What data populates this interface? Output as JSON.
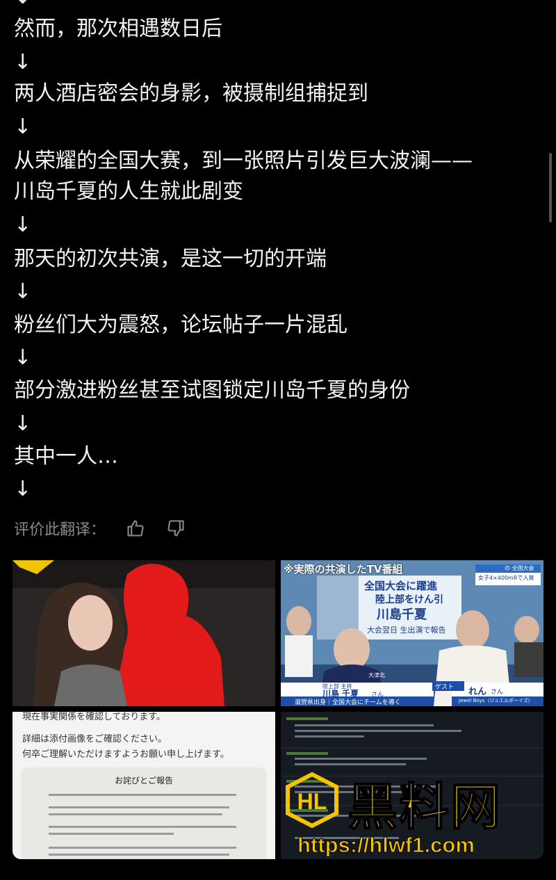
{
  "post": {
    "top_arrow": "↓",
    "lines": [
      "然而，那次相遇数日后",
      "↓",
      "两人酒店密会的身影，被摄制组捕捉到",
      "↓",
      "从荣耀的全国大赛，到一张照片引发巨大波澜——",
      "川岛千夏的人生就此剧变",
      "↓",
      "那天的初次共演，是这一切的开端",
      "↓",
      "粉丝们大为震怒，论坛帖子一片混乱",
      "↓",
      "部分激进粉丝甚至试图锁定川岛千夏的身份",
      "↓",
      "其中一人…",
      "↓"
    ]
  },
  "translation_rating": {
    "label": "评价此翻译：",
    "like_icon": "thumbs-up-icon",
    "dislike_icon": "thumbs-down-icon"
  },
  "images": {
    "tv_caption": "※実際の共演したTV番組",
    "tv_headline_1": "全国大会に躍進",
    "tv_headline_2": "陸上部をけん引",
    "tv_headline_3": "川島千夏",
    "tv_sub": "大会翌日 生出演で報告",
    "tv_top_right_1": "の 全国大会",
    "tv_top_right_2": "女子4×400mRで入賞",
    "tv_name_left": "川島 千夏",
    "tv_name_left_suffix": "さん",
    "tv_name_left_role": "陸上部 主将",
    "tv_name_left_desc": "滋賀県出身｜全国大会にチームを導く",
    "tv_guest_tag": "ゲスト",
    "tv_name_right": "れん",
    "tv_name_right_suffix": "さん",
    "tv_name_right_group": "Jewel Boys（ジュエルボーイズ）",
    "tv_jersey": "大津北",
    "doc_line_0": "現在事実関係を確認しております。",
    "doc_line_1": "詳細は添付画像をご確認ください。",
    "doc_line_2": "何卒ご理解いただけますようお願い申し上げます。",
    "doc_title": "お詫びとご報告",
    "watermark_text": "黑料网",
    "watermark_url": "https://hlwf1.com"
  },
  "colors": {
    "background": "#000000",
    "text": "#f2f2f2",
    "muted": "#8a8a8a",
    "watermark_yellow": "#f5c400"
  }
}
